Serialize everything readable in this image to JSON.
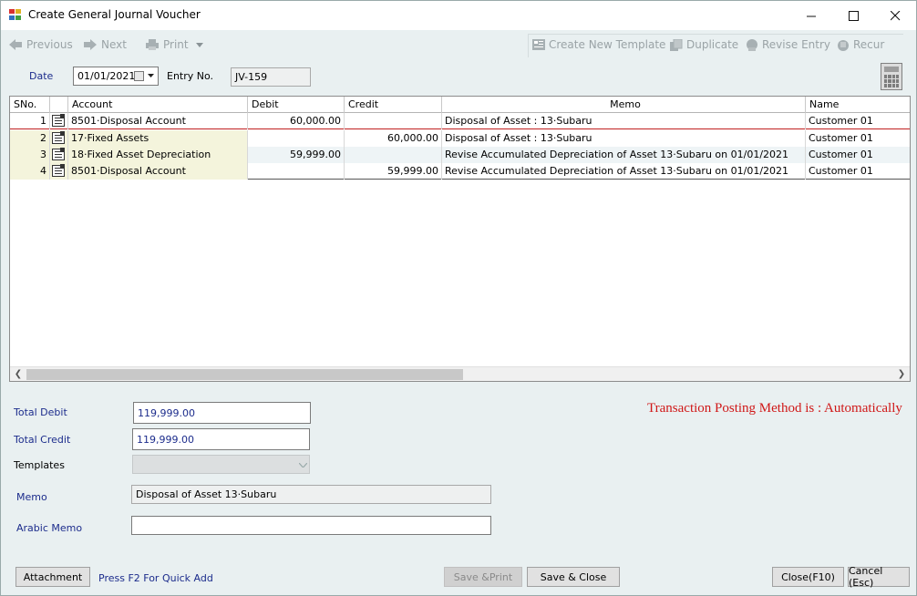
{
  "window": {
    "title": "Create General Journal Voucher"
  },
  "toolbar": {
    "previous": "Previous",
    "next": "Next",
    "print": "Print",
    "create_template": "Create New Template",
    "duplicate": "Duplicate",
    "revise_entry": "Revise Entry",
    "recur": "Recur"
  },
  "header": {
    "date_label": "Date",
    "date_value": "01/01/2021",
    "entry_label": "Entry No.",
    "entry_value": "JV-159"
  },
  "grid": {
    "columns": [
      "SNo.",
      "",
      "Account",
      "Debit",
      "Credit",
      "Memo",
      "Name"
    ],
    "rows": [
      {
        "sno": "1",
        "account": "8501·Disposal Account",
        "debit": "60,000.00",
        "credit": "",
        "memo": "Disposal of Asset : 13·Subaru",
        "name": "Customer 01"
      },
      {
        "sno": "2",
        "account": "17·Fixed Assets",
        "debit": "",
        "credit": "60,000.00",
        "memo": "Disposal of Asset : 13·Subaru",
        "name": "Customer 01"
      },
      {
        "sno": "3",
        "account": "18·Fixed Asset Depreciation",
        "debit": "59,999.00",
        "credit": "",
        "memo": "Revise Accumulated Depreciation of Asset 13·Subaru on 01/01/2021",
        "name": "Customer 01"
      },
      {
        "sno": "4",
        "account": "8501·Disposal Account",
        "debit": "",
        "credit": "59,999.00",
        "memo": "Revise Accumulated Depreciation of Asset 13·Subaru on 01/01/2021",
        "name": "Customer 01"
      }
    ]
  },
  "totals": {
    "debit_label": "Total Debit",
    "debit_value": "119,999.00",
    "credit_label": "Total Credit",
    "credit_value": "119,999.00"
  },
  "form": {
    "templates_label": "Templates",
    "memo_label": "Memo",
    "memo_value": "Disposal of Asset 13·Subaru",
    "arabic_memo_label": "Arabic Memo",
    "arabic_memo_value": ""
  },
  "status": {
    "posting_method": "Transaction Posting Method is : Automatically",
    "hint": "Press F2 For Quick Add"
  },
  "buttons": {
    "attachment": "Attachment",
    "save_print": "Save &Print",
    "save_close": "Save & Close",
    "close": "Close(F10)",
    "cancel": "Cancel (Esc)"
  },
  "colors": {
    "posting_text": "#d01818",
    "label_blue": "#1c2c8c",
    "row_highlight": "#f4f4dc",
    "row_border_red": "#c02020"
  }
}
